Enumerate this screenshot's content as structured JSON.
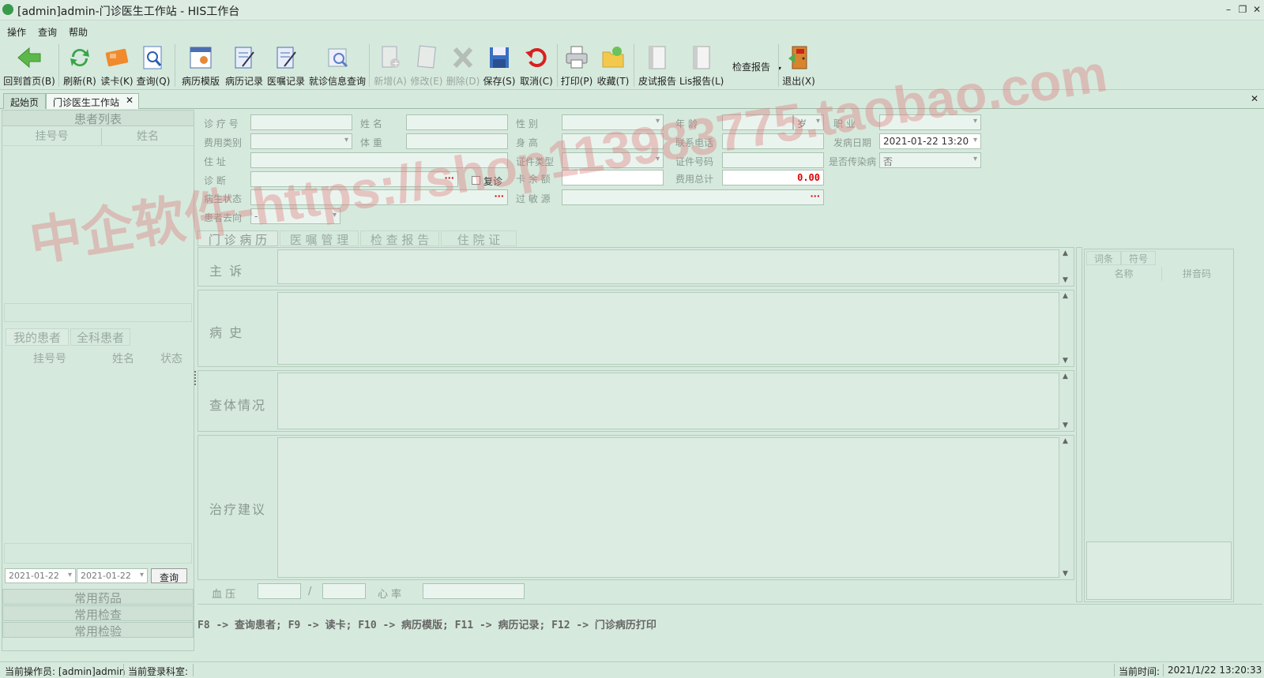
{
  "window": {
    "title": "[admin]admin-门诊医生工作站 - HIS工作台",
    "min": "–",
    "max": "❐",
    "close": "✕"
  },
  "menu": [
    "操作",
    "查询",
    "帮助"
  ],
  "toolbar": [
    {
      "label": "回到首页(B)",
      "icon": "back-arrow-icon"
    },
    {
      "label": "刷新(R)",
      "icon": "refresh-icon"
    },
    {
      "label": "读卡(K)",
      "icon": "card-icon"
    },
    {
      "label": "查询(Q)",
      "icon": "search-icon"
    },
    {
      "label": "病历模版",
      "icon": "template-icon"
    },
    {
      "label": "病历记录",
      "icon": "record-icon"
    },
    {
      "label": "医嘱记录",
      "icon": "order-icon"
    },
    {
      "label": "就诊信息查询",
      "icon": "visit-search-icon"
    },
    {
      "label": "新增(A)",
      "icon": "add-icon"
    },
    {
      "label": "修改(E)",
      "icon": "edit-icon"
    },
    {
      "label": "删除(D)",
      "icon": "delete-icon"
    },
    {
      "label": "保存(S)",
      "icon": "save-icon"
    },
    {
      "label": "取消(C)",
      "icon": "cancel-icon"
    },
    {
      "label": "打印(P)",
      "icon": "print-icon"
    },
    {
      "label": "收藏(T)",
      "icon": "favorite-folder-icon"
    },
    {
      "label": "皮试报告",
      "icon": "skin-test-icon"
    },
    {
      "label": "Lis报告(L)",
      "icon": "lis-icon"
    },
    {
      "label": "检查报告",
      "icon": ""
    },
    {
      "label": "退出(X)",
      "icon": "exit-icon"
    }
  ],
  "tabs": [
    "起始页",
    "门诊医生工作站"
  ],
  "tab_close": "✕",
  "left": {
    "patient_list": "患者列表",
    "reg_no": "挂号号",
    "name": "姓名",
    "my_patients": "我的患者",
    "all_patients": "全科患者",
    "status": "状态",
    "date_from": "2021-01-22",
    "date_to": "2021-01-22",
    "query": "查询",
    "common_drugs": "常用药品",
    "common_exam": "常用检查",
    "common_test": "常用检验"
  },
  "form": {
    "clinic_no": "诊 疗 号",
    "name": "姓    名",
    "gender": "性    别",
    "age": "年    龄",
    "age_unit": "岁",
    "job": "职    业",
    "fee_type": "费用类别",
    "weight": "体    重",
    "height": "身    高",
    "phone": "联系电话",
    "onset_date": "发病日期",
    "onset_value": "2021-01-22 13:20",
    "address": "住    址",
    "id_type": "证件类型",
    "id_no": "证件号码",
    "infectious": "是否传染病",
    "infectious_value": "否",
    "diagnosis": "诊    断",
    "revisit": "复诊",
    "card_balance": "卡 余 额",
    "total_fee": "费用总计",
    "total_value": "0.00",
    "condition": "病生状态",
    "allergy": "过 敏 源",
    "destination": "患者去向",
    "destination_value": "-"
  },
  "subtabs": [
    "门 诊 病 历",
    "医 嘱 管 理",
    "检 查 报 告",
    "住   院   证"
  ],
  "sections": [
    "主    诉",
    "病    史",
    "查体情况",
    "治疗建议"
  ],
  "vitals": {
    "bp": "血    压",
    "slash": "/",
    "hr": "心    率"
  },
  "hotkeys": "F8 -> 查询患者; F9 -> 读卡; F10 -> 病历模版; F11 -> 病历记录; F12 -> 门诊病历打印",
  "right": {
    "tab1": "词条",
    "tab2": "符号",
    "col1": "名称",
    "col2": "拼音码"
  },
  "status": {
    "operator": "当前操作员: [admin]admin",
    "dept": "当前登录科室:",
    "time_label": "当前时间:",
    "time": "2021/1/22 13:20:33"
  },
  "watermark": "中企软件-https://shop113983775.taobao.com"
}
